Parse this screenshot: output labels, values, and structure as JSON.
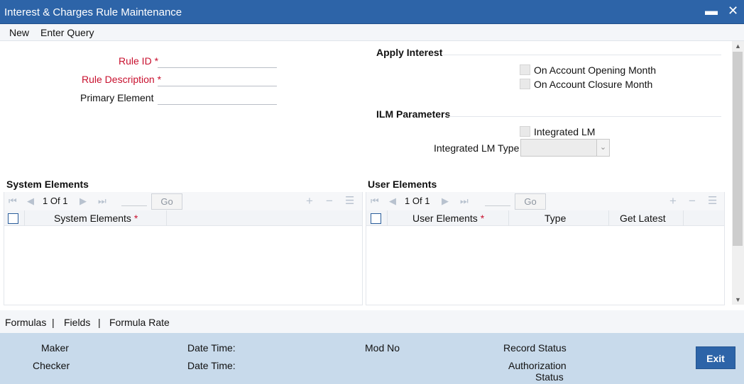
{
  "window": {
    "title": "Interest & Charges Rule Maintenance",
    "minimize_glyph": "▬",
    "close_glyph": "✕"
  },
  "menu": {
    "new": "New",
    "enter_query": "Enter Query"
  },
  "form": {
    "rule_id_label": "Rule ID",
    "rule_desc_label": "Rule Description",
    "primary_element_label": "Primary Element",
    "required_mark": "*",
    "rule_id_value": "",
    "rule_desc_value": "",
    "primary_element_value": ""
  },
  "apply_interest": {
    "heading": "Apply Interest",
    "opening_month": "On Account Opening Month",
    "closure_month": "On Account Closure Month"
  },
  "ilm": {
    "heading": "ILM Parameters",
    "integrated_lm": "Integrated LM",
    "integrated_lm_type_label": "Integrated LM Type",
    "integrated_lm_type_value": ""
  },
  "system_grid": {
    "heading": "System Elements",
    "page_current": "1",
    "page_of": "Of",
    "page_total": "1",
    "go": "Go",
    "columns": [
      "System Elements"
    ],
    "required_mark": "*"
  },
  "user_grid": {
    "heading": "User Elements",
    "page_current": "1",
    "page_of": "Of",
    "page_total": "1",
    "go": "Go",
    "columns": [
      "User Elements",
      "Type",
      "Get Latest"
    ],
    "required_mark": "*"
  },
  "links": {
    "formulas": "Formulas",
    "sep": "|",
    "fields": "Fields",
    "formula_rate": "Formula Rate"
  },
  "footer": {
    "maker": "Maker",
    "checker": "Checker",
    "date_time": "Date Time:",
    "mod_no": "Mod No",
    "record_status": "Record Status",
    "authorization": "Authorization",
    "status": "Status",
    "exit": "Exit"
  },
  "colors": {
    "titlebar": "#2d64a8",
    "required": "#c8102e",
    "footer": "#c8daeb"
  }
}
